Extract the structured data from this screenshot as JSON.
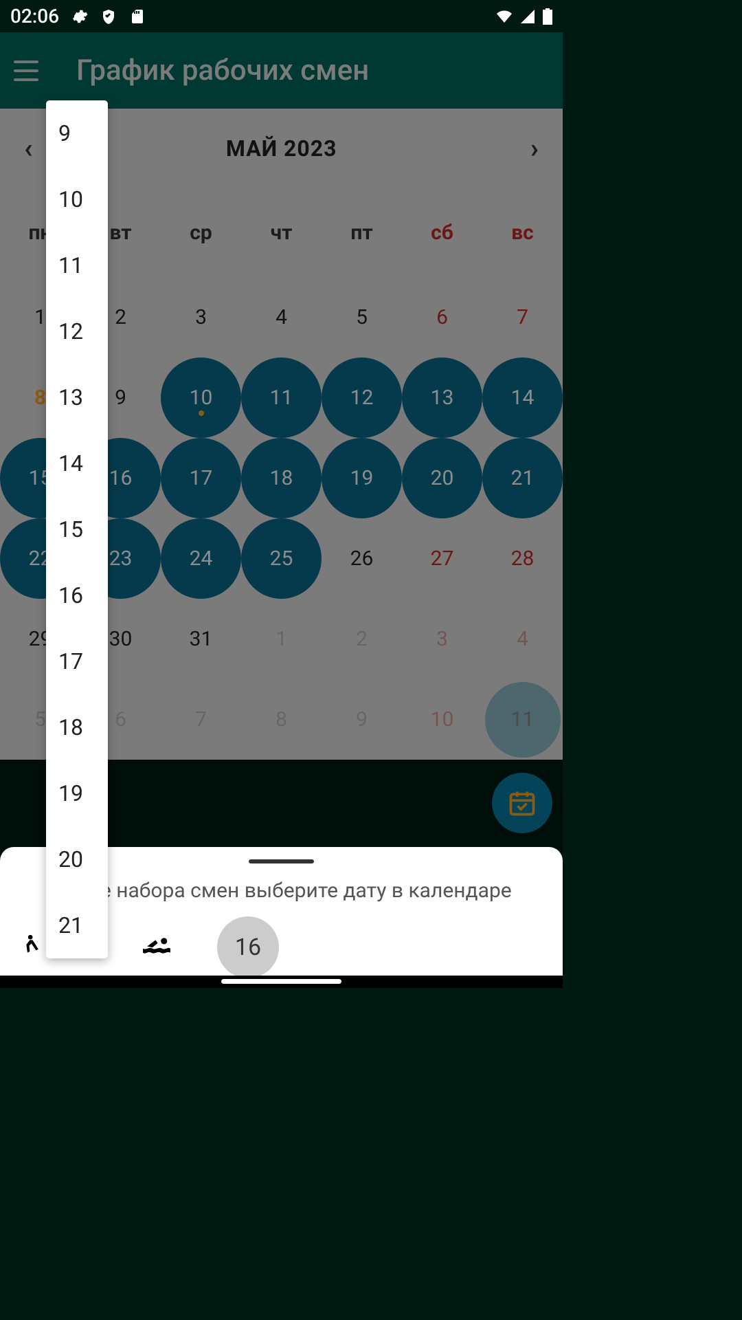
{
  "status": {
    "time": "02:06"
  },
  "app": {
    "title": "График рабочих смен"
  },
  "month": {
    "label": "МАЙ 2023"
  },
  "weekdays": [
    "пн",
    "вт",
    "ср",
    "чт",
    "пт",
    "сб",
    "вс"
  ],
  "rows": [
    [
      {
        "n": "1"
      },
      {
        "n": "2"
      },
      {
        "n": "3"
      },
      {
        "n": "4"
      },
      {
        "n": "5"
      },
      {
        "n": "6",
        "weekend": true
      },
      {
        "n": "7",
        "weekend": true
      }
    ],
    [
      {
        "n": "8",
        "selected": true
      },
      {
        "n": "9"
      },
      {
        "n": "10",
        "shift": true,
        "dot": true
      },
      {
        "n": "11",
        "shift": true
      },
      {
        "n": "12",
        "shift": true
      },
      {
        "n": "13",
        "shift": true
      },
      {
        "n": "14",
        "shift": true
      }
    ],
    [
      {
        "n": "15",
        "shift": true
      },
      {
        "n": "16",
        "shift": true
      },
      {
        "n": "17",
        "shift": true
      },
      {
        "n": "18",
        "shift": true
      },
      {
        "n": "19",
        "shift": true
      },
      {
        "n": "20",
        "shift": true
      },
      {
        "n": "21",
        "shift": true
      }
    ],
    [
      {
        "n": "22",
        "shift": true
      },
      {
        "n": "23",
        "shift": true
      },
      {
        "n": "24",
        "shift": true
      },
      {
        "n": "25",
        "shift": true
      },
      {
        "n": "26"
      },
      {
        "n": "27",
        "weekend": true
      },
      {
        "n": "28",
        "weekend": true
      }
    ],
    [
      {
        "n": "29"
      },
      {
        "n": "30"
      },
      {
        "n": "31"
      },
      {
        "n": "1",
        "outside": true
      },
      {
        "n": "2",
        "outside": true
      },
      {
        "n": "3",
        "outside": true,
        "weekend": true
      },
      {
        "n": "4",
        "outside": true,
        "weekend": true
      }
    ],
    [
      {
        "n": "5",
        "outside": true
      },
      {
        "n": "6",
        "outside": true
      },
      {
        "n": "7",
        "outside": true
      },
      {
        "n": "8",
        "outside": true
      },
      {
        "n": "9",
        "outside": true
      },
      {
        "n": "10",
        "outside": true,
        "weekend": true
      },
      {
        "n": "11",
        "today": true
      }
    ]
  ],
  "sheet": {
    "text": "После набора смен выберите дату в календаре",
    "value": "16"
  },
  "dropdown": {
    "items": [
      "9",
      "10",
      "11",
      "12",
      "13",
      "14",
      "15",
      "16",
      "17",
      "18",
      "19",
      "20",
      "21"
    ]
  }
}
